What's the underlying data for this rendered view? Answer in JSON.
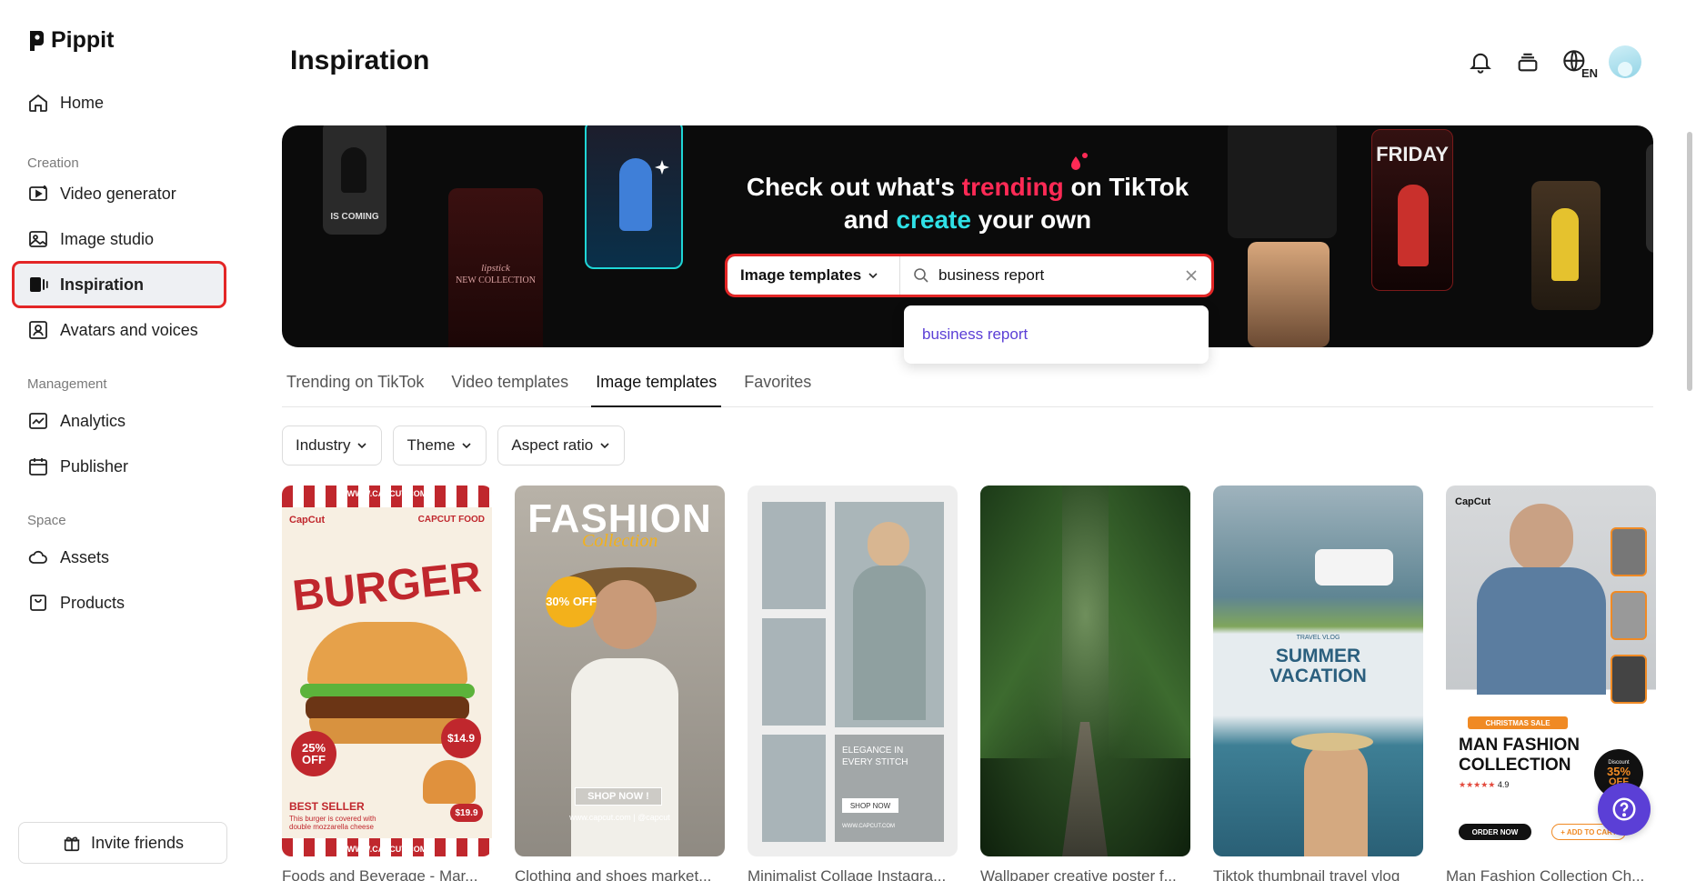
{
  "app": {
    "name": "Pippit"
  },
  "sidebar": {
    "home": "Home",
    "sections": {
      "creation": "Creation",
      "management": "Management",
      "space": "Space"
    },
    "creation_items": [
      "Video generator",
      "Image studio",
      "Inspiration",
      "Avatars and voices"
    ],
    "management_items": [
      "Analytics",
      "Publisher"
    ],
    "space_items": [
      "Assets",
      "Products"
    ],
    "active": "Inspiration",
    "invite": "Invite friends"
  },
  "header": {
    "title": "Inspiration",
    "lang": "EN"
  },
  "banner": {
    "line1_prefix": "Check out what's ",
    "line1_highlight": "trending",
    "line1_suffix": " on TikTok",
    "line2_prefix": "and ",
    "line2_highlight": "create",
    "line2_suffix": " your own",
    "thumbs": {
      "coming": "IS COMING",
      "lipstick": "lipstick",
      "collection": "NEW COLLECTION",
      "friday": "FRIDAY"
    }
  },
  "search": {
    "type": "Image templates",
    "value": "business report",
    "suggestion": "business report"
  },
  "tabs": [
    "Trending on TikTok",
    "Video templates",
    "Image templates",
    "Favorites"
  ],
  "active_tab": "Image templates",
  "filters": [
    "Industry",
    "Theme",
    "Aspect ratio"
  ],
  "cards": [
    {
      "title": "Foods and Beverage - Mar...",
      "art": {
        "brand": "CapCut",
        "tag": "CAPCUT FOOD",
        "url": "WWW.CAPCUT.COM",
        "headline": "BURGER",
        "discount": "25% OFF",
        "price": "$14.9",
        "price_small": "$19.9",
        "label": "BEST SELLER",
        "desc": "This burger is covered with double mozzarella cheese"
      }
    },
    {
      "title": "Clothing and shoes market...",
      "art": {
        "headline": "FASHION",
        "script": "Collection",
        "discount": "30% OFF",
        "cta": "SHOP NOW !",
        "footer": "www.capcut.com | @capcut"
      }
    },
    {
      "title": "Minimalist Collage Instagra...",
      "art": {
        "line1": "ELEGANCE IN",
        "line2": "EVERY STITCH",
        "cta": "SHOP NOW",
        "url": "WWW.CAPCUT.COM"
      }
    },
    {
      "title": "Wallpaper creative poster f...",
      "art": {}
    },
    {
      "title": "Tiktok thumbnail travel vlog",
      "art": {
        "small": "TRAVEL VLOG",
        "line1": "SUMMER",
        "line2": "VACATION"
      }
    },
    {
      "title": "Man Fashion Collection Ch...",
      "art": {
        "brand": "CapCut",
        "sale": "CHRISTMAS SALE",
        "line1": "MAN FASHION",
        "line2": "COLLECTION",
        "discount": "35%",
        "off": "OFF",
        "disc_label": "Discount",
        "rating": "4.9",
        "order": "ORDER NOW",
        "cart": "+ ADD TO CART"
      }
    }
  ],
  "colors": {
    "accent": "#5b3fd6",
    "highlight_red": "#e32626",
    "pink": "#ff2a55",
    "cyan": "#2fe0e6"
  }
}
